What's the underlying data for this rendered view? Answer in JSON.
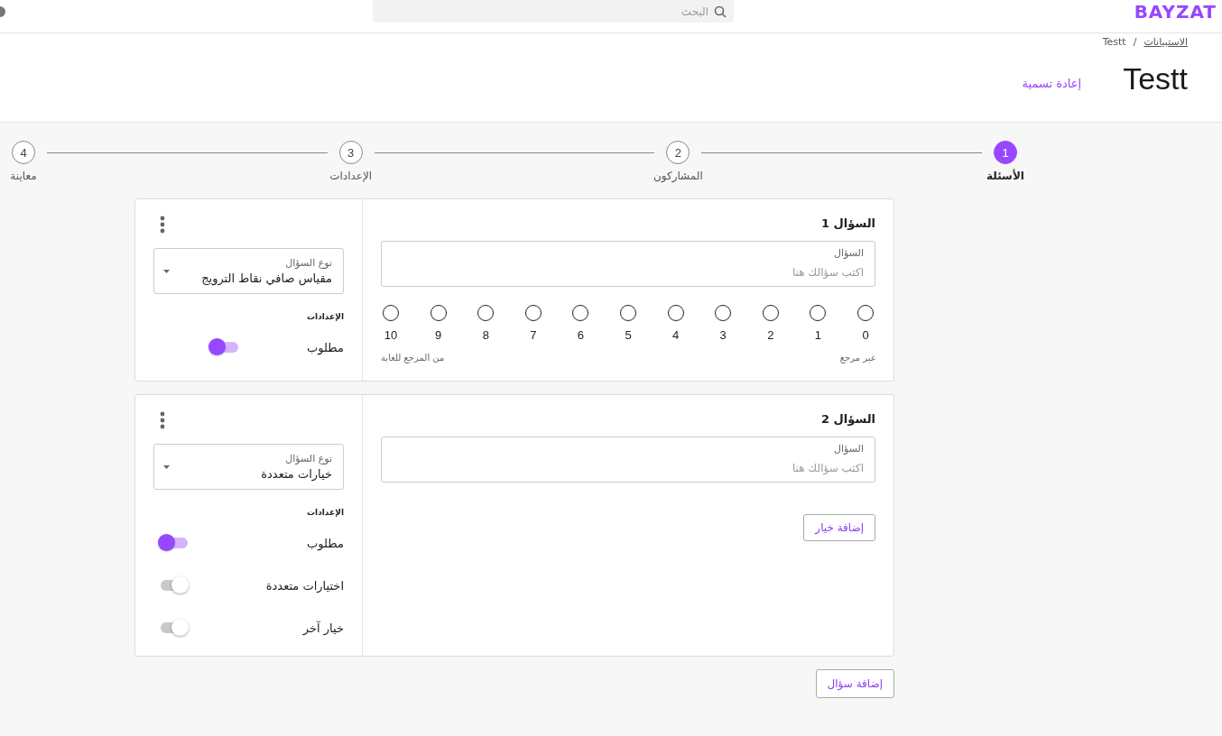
{
  "header": {
    "logo": "BAYZAT",
    "search": {
      "placeholder": "البحث"
    }
  },
  "breadcrumb": {
    "items": [
      {
        "label": "الاستبيانات",
        "link": true
      },
      {
        "label": "Testt",
        "link": false
      }
    ],
    "separator": "/"
  },
  "title": "Testt",
  "rename": "إعادة تسمية",
  "steps": [
    {
      "number": "1",
      "label": "الأسئلة",
      "selected": true
    },
    {
      "number": "2",
      "label": "المشاركون",
      "selected": false
    },
    {
      "number": "3",
      "label": "الإعدادات",
      "selected": false
    },
    {
      "number": "4",
      "label": "معاينة",
      "selected": false
    }
  ],
  "questions": [
    {
      "kind": "nps",
      "title": "السؤال 1",
      "field": {
        "label": "السؤال",
        "placeholder": "اكتب سؤالك هنا"
      },
      "scale": [
        {
          "label": "0",
          "selected": false
        },
        {
          "label": "1",
          "selected": false
        },
        {
          "label": "2",
          "selected": false
        },
        {
          "label": "3",
          "selected": false
        },
        {
          "label": "4",
          "selected": false
        },
        {
          "label": "5",
          "selected": false
        },
        {
          "label": "6",
          "selected": false
        },
        {
          "label": "7",
          "selected": false
        },
        {
          "label": "8",
          "selected": false
        },
        {
          "label": "9",
          "selected": false
        },
        {
          "label": "10",
          "selected": false
        }
      ],
      "scale_low": "غير مرجع",
      "scale_high": "من المرجع للغاية",
      "type": {
        "label": "نوع السؤال",
        "value": "مقياس صافي نقاط الترويج"
      },
      "settings_title": "الإعدادات",
      "settings": [
        {
          "label": "مطلوب",
          "on": true
        }
      ]
    },
    {
      "kind": "choice",
      "title": "السؤال 2",
      "field": {
        "label": "السؤال",
        "placeholder": "اكتب سؤالك هنا"
      },
      "add_option": "إضافة خيار",
      "type": {
        "label": "نوع السؤال",
        "value": "خيارات متعددة"
      },
      "settings_title": "الإعدادات",
      "settings": [
        {
          "label": "مطلوب",
          "on": true
        },
        {
          "label": "اختيارات متعددة",
          "on": false
        },
        {
          "label": "خيار آخر",
          "on": false
        }
      ]
    }
  ],
  "add_question": "إضافة سؤال"
}
